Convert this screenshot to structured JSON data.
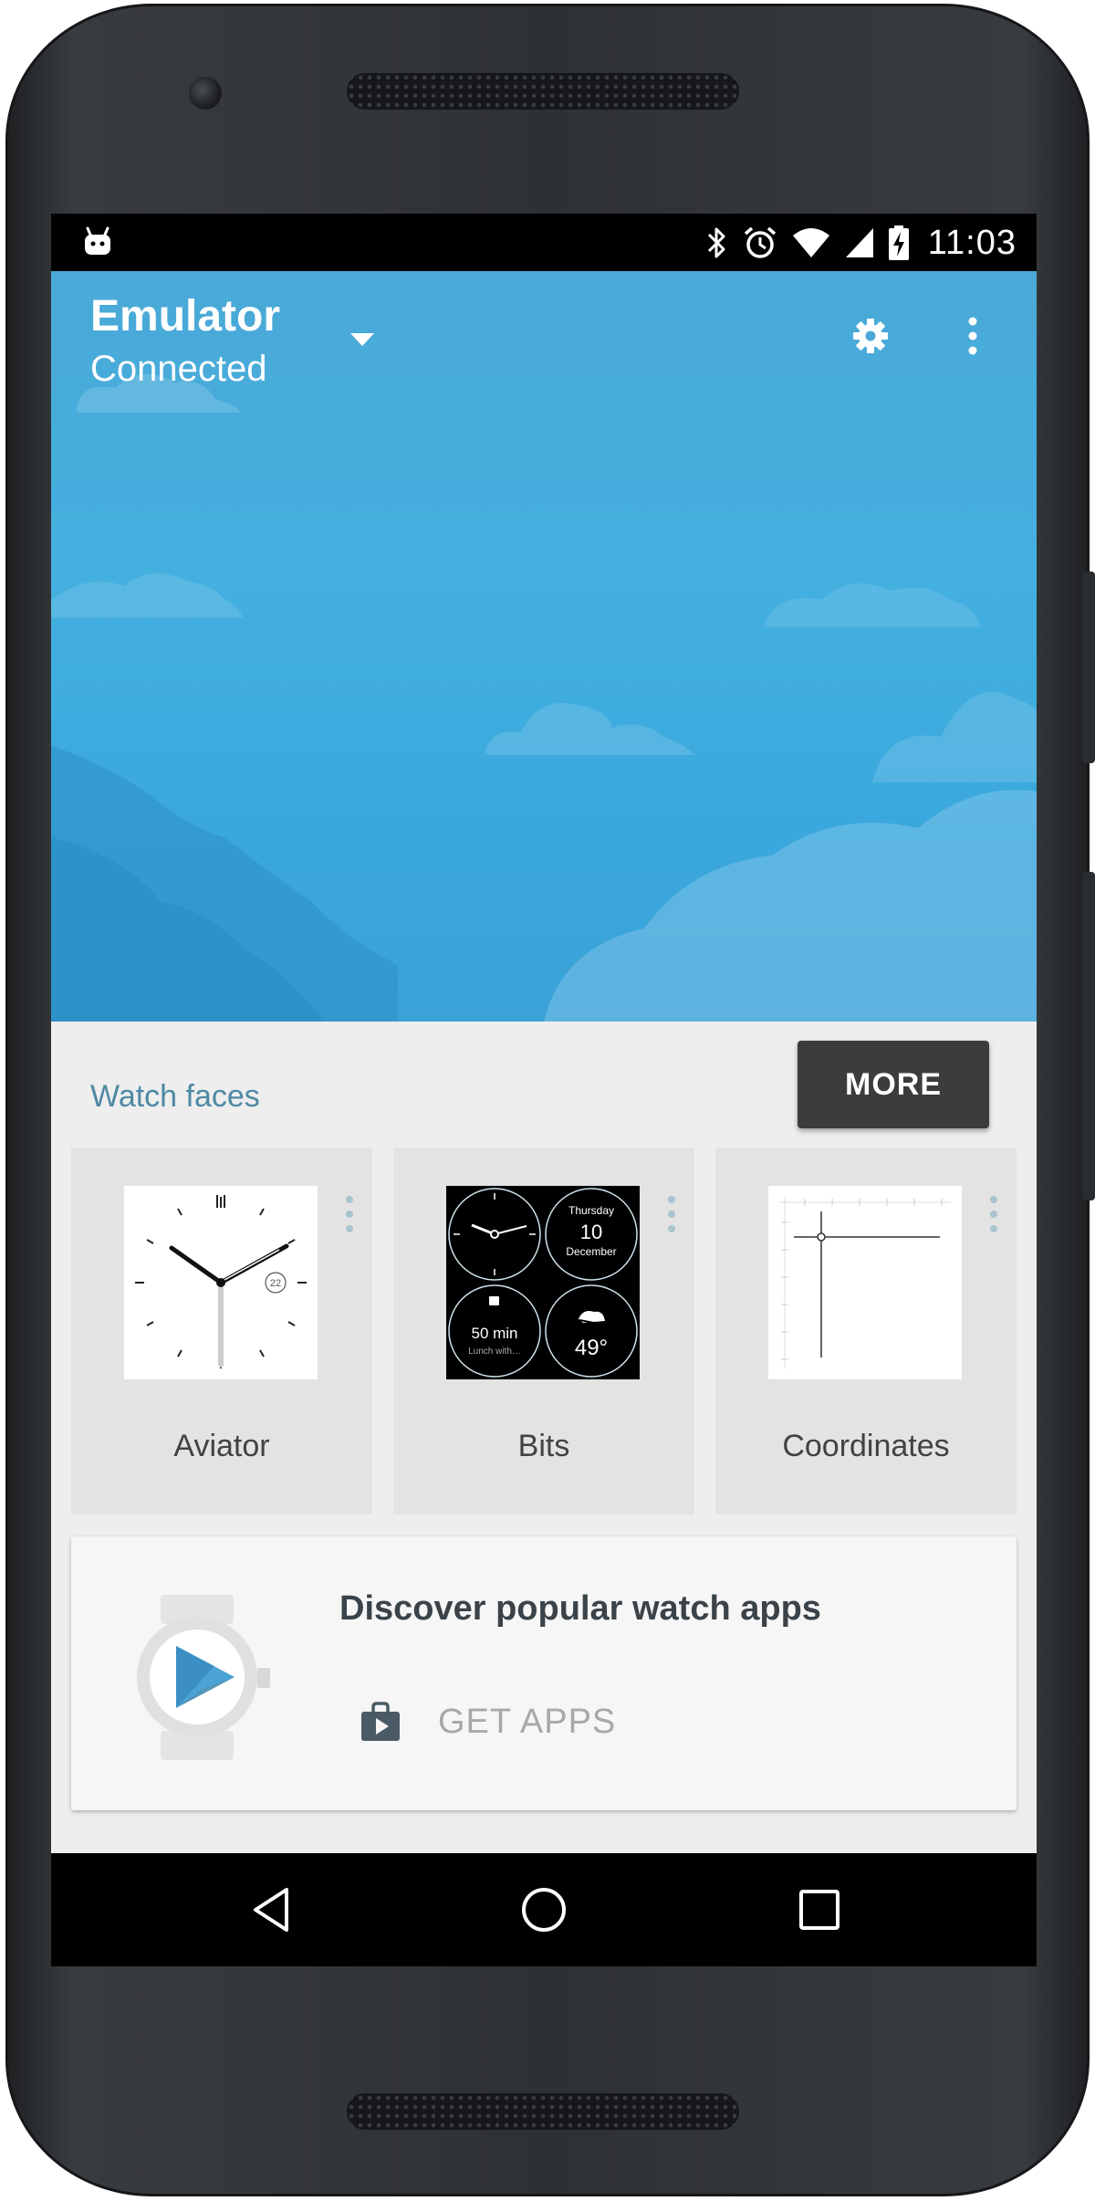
{
  "status_bar": {
    "time": "11:03",
    "icons": [
      "android-debug-icon",
      "bluetooth-icon",
      "alarm-icon",
      "wifi-icon",
      "signal-icon",
      "battery-charging-icon"
    ]
  },
  "header": {
    "device_name": "Emulator",
    "connection_status": "Connected",
    "icons": [
      "dropdown-arrow-icon",
      "settings-gear-icon",
      "overflow-menu-icon"
    ],
    "background_color": "#44b0e0"
  },
  "watch_faces": {
    "section_label": "Watch faces",
    "more_label": "MORE",
    "items": [
      {
        "name": "Aviator",
        "date": "22"
      },
      {
        "name": "Bits",
        "day": "Thursday",
        "day_num": "10",
        "month": "December",
        "timer": "50 min",
        "timer_sub": "Lunch with…",
        "temperature": "49°"
      },
      {
        "name": "Coordinates"
      }
    ]
  },
  "discover": {
    "title": "Discover popular watch apps",
    "button_label": "GET APPS"
  },
  "nav_bar": {
    "icons": [
      "back-icon",
      "home-icon",
      "recents-icon"
    ]
  },
  "colors": {
    "accent": "#4f89a4",
    "more_button": "#3c3c3e",
    "card": "#e3e3e3"
  }
}
